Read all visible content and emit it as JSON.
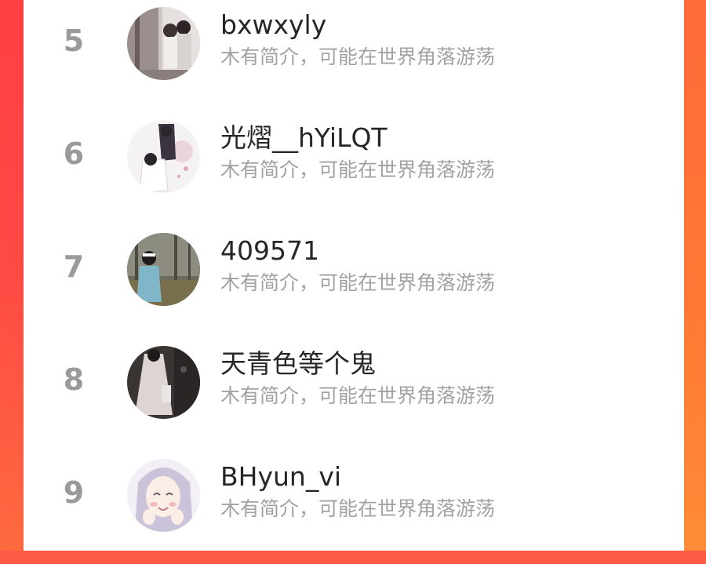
{
  "ranking_list": [
    {
      "rank": "5",
      "name": "bxwxyly",
      "bio": "木有简介，可能在世界角落游荡",
      "avatar": "avatar-photo-couple"
    },
    {
      "rank": "6",
      "name": "光熠__hYiLQT",
      "bio": "木有简介，可能在世界角落游荡",
      "avatar": "avatar-illustration-couple"
    },
    {
      "rank": "7",
      "name": "409571",
      "bio": "木有简介，可能在世界角落游荡",
      "avatar": "avatar-photo-girl-forest"
    },
    {
      "rank": "8",
      "name": "天青色等个鬼",
      "bio": "木有简介，可能在世界角落游荡",
      "avatar": "avatar-photo-white-dress"
    },
    {
      "rank": "9",
      "name": "BHyun_vi",
      "bio": "木有简介，可能在世界角落游荡",
      "avatar": "avatar-illustration-girl"
    }
  ],
  "colors": {
    "background_gradient_top": "#ff5a45",
    "background_gradient_bottom": "#ff8a3a",
    "rank_text": "#9a9a9a",
    "name_text": "#262626",
    "bio_text": "#a2a2a2",
    "panel": "#ffffff"
  }
}
